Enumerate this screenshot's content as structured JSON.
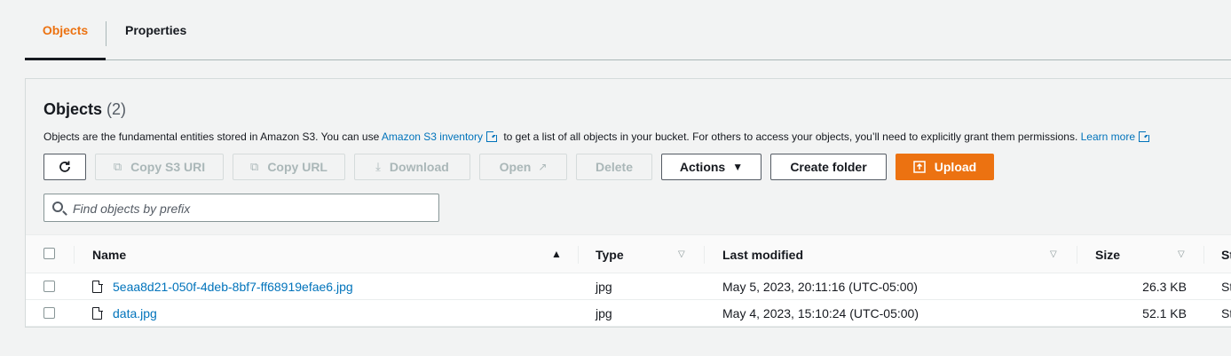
{
  "tabs": [
    {
      "label": "Objects"
    },
    {
      "label": "Properties"
    }
  ],
  "panel": {
    "title": "Objects",
    "count": "(2)",
    "description": {
      "before": "Objects are the fundamental entities stored in Amazon S3. You can use ",
      "link1": "Amazon S3 inventory",
      "middle": " to get a list of all objects in your bucket. For others to access your objects, you’ll need to explicitly grant them permissions. ",
      "link2": "Learn more"
    }
  },
  "toolbar": {
    "refresh_icon": "refresh-icon",
    "copy_s3_uri": "Copy S3 URI",
    "copy_url": "Copy URL",
    "download": "Download",
    "open": "Open",
    "delete": "Delete",
    "actions": "Actions",
    "create_folder": "Create folder",
    "upload": "Upload"
  },
  "search": {
    "placeholder": "Find objects by prefix",
    "value": ""
  },
  "table": {
    "headers": {
      "name": "Name",
      "type": "Type",
      "last_modified": "Last modified",
      "size": "Size",
      "storage_class": "St"
    },
    "rows": [
      {
        "name": "5eaa8d21-050f-4deb-8bf7-ff68919efae6.jpg",
        "type": "jpg",
        "last_modified": "May 5, 2023, 20:11:16 (UTC-05:00)",
        "size": "26.3 KB",
        "storage_class": "St"
      },
      {
        "name": "data.jpg",
        "type": "jpg",
        "last_modified": "May 4, 2023, 15:10:24 (UTC-05:00)",
        "size": "52.1 KB",
        "storage_class": "St"
      }
    ]
  },
  "colors": {
    "accent": "#ec7211",
    "link": "#0073bb",
    "text": "#16191f",
    "muted": "#aab7b8"
  }
}
